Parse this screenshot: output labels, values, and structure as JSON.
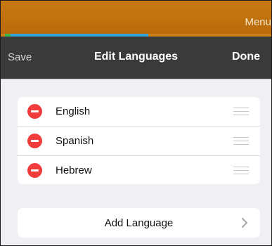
{
  "appbar": {
    "menu_label": "Menu",
    "accent": "#c97a12"
  },
  "modal": {
    "save_label": "Save",
    "title": "Edit Languages",
    "done_label": "Done"
  },
  "languages": [
    {
      "label": "English"
    },
    {
      "label": "Spanish"
    },
    {
      "label": "Hebrew"
    }
  ],
  "add_language_label": "Add Language",
  "icons": {
    "delete": "minus-circle-icon",
    "reorder": "reorder-handle-icon",
    "chevron": "chevron-right-icon"
  }
}
